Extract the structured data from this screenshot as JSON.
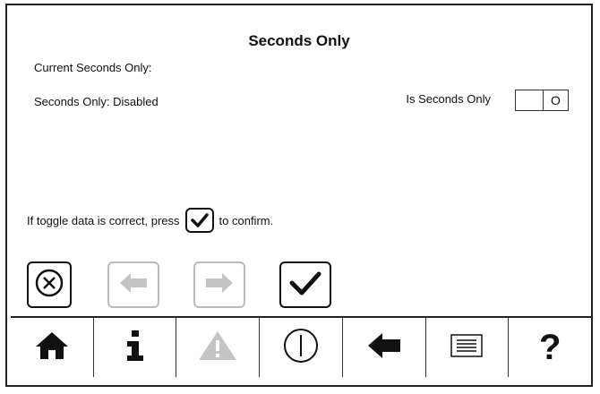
{
  "header": {
    "title": "Seconds Only"
  },
  "status": {
    "current_label": "Current Seconds Only:",
    "state_text": "Seconds Only: Disabled"
  },
  "toggle": {
    "label": "Is Seconds Only",
    "on_symbol": "O"
  },
  "confirm": {
    "before": "If toggle data is correct, press",
    "after": "to confirm."
  },
  "footer": {
    "help_symbol": "?"
  }
}
